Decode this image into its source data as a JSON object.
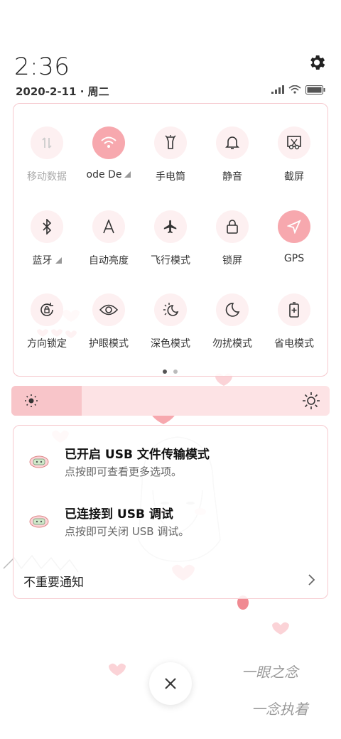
{
  "status": {
    "time": "2:36",
    "date": "2020-2-11 · 周二"
  },
  "toggles": [
    {
      "label": "移动数据",
      "icon": "mobile-data-icon",
      "state": "disabled"
    },
    {
      "label": "ode  De",
      "icon": "wifi-icon",
      "state": "on",
      "has_menu": true
    },
    {
      "label": "手电筒",
      "icon": "flashlight-icon",
      "state": "off"
    },
    {
      "label": "静音",
      "icon": "bell-icon",
      "state": "off"
    },
    {
      "label": "截屏",
      "icon": "screenshot-icon",
      "state": "off"
    },
    {
      "label": "蓝牙",
      "icon": "bluetooth-icon",
      "state": "off",
      "has_menu": true
    },
    {
      "label": "自动亮度",
      "icon": "auto-brightness-icon",
      "state": "off"
    },
    {
      "label": "飞行模式",
      "icon": "airplane-icon",
      "state": "off"
    },
    {
      "label": "锁屏",
      "icon": "lock-icon",
      "state": "off"
    },
    {
      "label": "GPS",
      "icon": "location-icon",
      "state": "on"
    },
    {
      "label": "方向锁定",
      "icon": "rotation-lock-icon",
      "state": "off"
    },
    {
      "label": "护眼模式",
      "icon": "eye-icon",
      "state": "off"
    },
    {
      "label": "深色模式",
      "icon": "dark-mode-icon",
      "state": "off"
    },
    {
      "label": "勿扰模式",
      "icon": "moon-icon",
      "state": "off"
    },
    {
      "label": "省电模式",
      "icon": "battery-saver-icon",
      "state": "off"
    }
  ],
  "pager": {
    "pages": 2,
    "active": 1
  },
  "brightness": {
    "level": 0.22
  },
  "notifications": [
    {
      "title": "已开启 USB 文件传输模式",
      "subtitle": "点按即可查看更多选项。",
      "icon": "android-usb-icon"
    },
    {
      "title": "已连接到 USB 调试",
      "subtitle": "点按即可关闭 USB 调试。",
      "icon": "android-usb-icon"
    }
  ],
  "unimportant_label": "不重要通知",
  "wallpaper_text": [
    "一眼之念",
    "一念执着"
  ],
  "colors": {
    "accent": "#f7a8ae",
    "panel_border": "#f6c9ce",
    "brightness_fill": "#f8c5c9"
  }
}
